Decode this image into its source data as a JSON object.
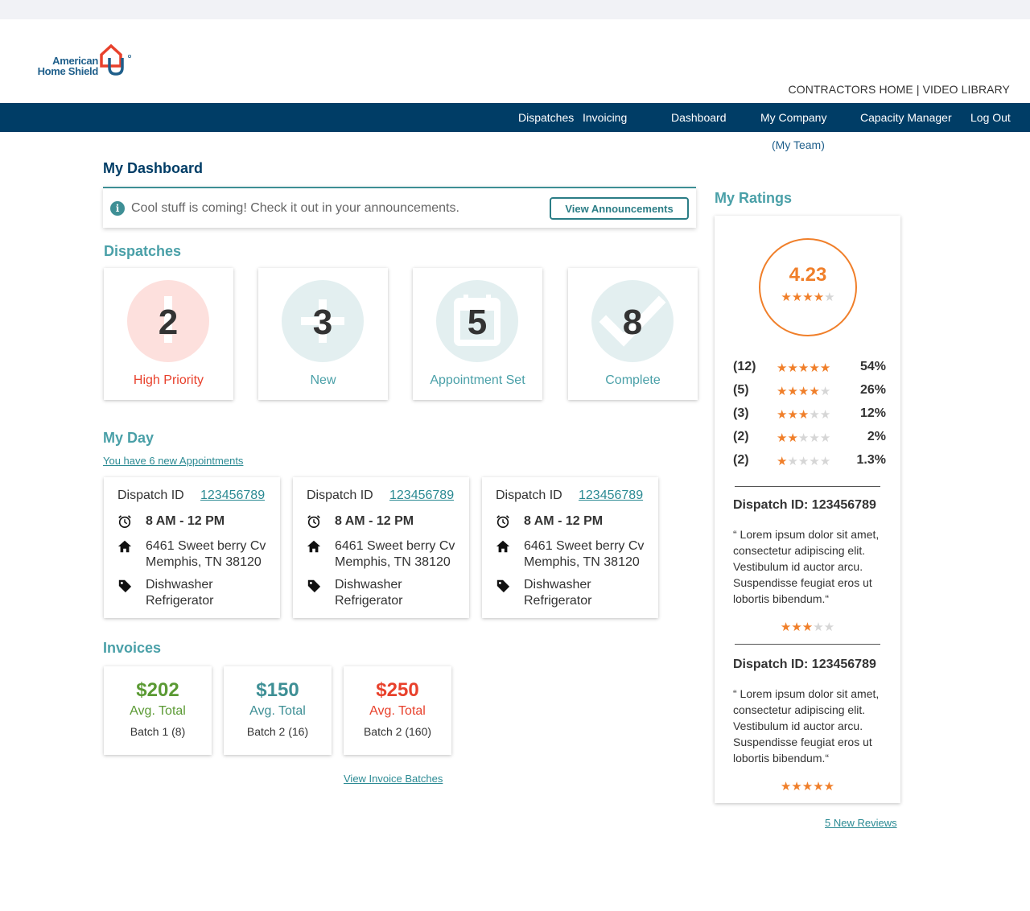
{
  "brand": {
    "name_line1": "American",
    "name_line2": "Home Shield",
    "red": "#e8412c",
    "blue": "#1f5f8b"
  },
  "toplinks": {
    "contractors_home": "CONTRACTORS HOME",
    "separator": " | ",
    "video_library": "VIDEO LIBRARY"
  },
  "nav": {
    "items": [
      "Dispatches",
      "Invoicing",
      "Dashboard",
      "My Company",
      "Capacity Manager",
      "Log Out"
    ],
    "sub_item": "(My Team)",
    "bg_color": "#003d66"
  },
  "page_title": "My Dashboard",
  "announcement": {
    "icon": "info-icon",
    "message": "Cool stuff is coming! Check it out in your announcements.",
    "button": "View Announcements"
  },
  "dispatches": {
    "title": "Dispatches",
    "cards": [
      {
        "count": "2",
        "label": "High Priority",
        "icon": "exclamation-icon",
        "circle_color": "#fde0dd",
        "label_color": "#e8412c"
      },
      {
        "count": "3",
        "label": "New",
        "icon": "plus-icon",
        "circle_color": "#e3eff0",
        "label_color": "#4aa0a8"
      },
      {
        "count": "5",
        "label": "Appointment Set",
        "icon": "calendar-icon",
        "circle_color": "#e3eff0",
        "label_color": "#4aa0a8"
      },
      {
        "count": "8",
        "label": "Complete",
        "icon": "checkmark-icon",
        "circle_color": "#e3eff0",
        "label_color": "#4aa0a8"
      }
    ]
  },
  "my_day": {
    "title": "My Day",
    "link": "You have 6 new Appointments",
    "appointments": [
      {
        "id_label": "Dispatch ID",
        "id": "123456789",
        "time": "8 AM - 12 PM",
        "address1": "6461 Sweet berry Cv",
        "address2": "Memphis, TN 38120",
        "item1": "Dishwasher",
        "item2": "Refrigerator"
      },
      {
        "id_label": "Dispatch ID",
        "id": "123456789",
        "time": "8 AM - 12 PM",
        "address1": "6461 Sweet berry Cv",
        "address2": "Memphis, TN 38120",
        "item1": "Dishwasher",
        "item2": "Refrigerator"
      },
      {
        "id_label": "Dispatch ID",
        "id": "123456789",
        "time": "8 AM - 12 PM",
        "address1": "6461 Sweet berry Cv",
        "address2": "Memphis, TN 38120",
        "item1": "Dishwasher",
        "item2": "Refrigerator"
      }
    ]
  },
  "invoices": {
    "title": "Invoices",
    "cards": [
      {
        "amount": "$202",
        "avg_label": "Avg. Total",
        "batch": "Batch 1 (8)",
        "color": "#5b9a34"
      },
      {
        "amount": "$150",
        "avg_label": "Avg. Total",
        "batch": "Batch 2 (16)",
        "color": "#3e8f95"
      },
      {
        "amount": "$250",
        "avg_label": "Avg. Total",
        "batch": "Batch 2 (160)",
        "color": "#e8412c"
      }
    ],
    "link": "View Invoice Batches"
  },
  "ratings": {
    "title": "My Ratings",
    "score": "4.23",
    "score_stars": 4,
    "breakdown": [
      {
        "count": "(12)",
        "stars": 5,
        "percent": "54%"
      },
      {
        "count": "(5)",
        "stars": 4,
        "percent": "26%"
      },
      {
        "count": "(3)",
        "stars": 3,
        "percent": "12%"
      },
      {
        "count": "(2)",
        "stars": 2,
        "percent": "2%"
      },
      {
        "count": "(2)",
        "stars": 1,
        "percent": "1.3%"
      }
    ],
    "reviews": [
      {
        "title": "Dispatch ID: 123456789",
        "text": "“ Lorem ipsum dolor sit amet, consectetur adipiscing elit. Vestibulum id auctor arcu. Suspendisse feugiat eros ut lobortis bibendum.“",
        "stars": 3
      },
      {
        "title": "Dispatch ID: 123456789",
        "text": "“ Lorem ipsum dolor sit amet, consectetur adipiscing elit. Vestibulum id auctor arcu. Suspendisse feugiat eros ut lobortis bibendum.“",
        "stars": 5
      }
    ],
    "new_reviews_link": "5 New Reviews",
    "accent": "#f07f2a"
  }
}
